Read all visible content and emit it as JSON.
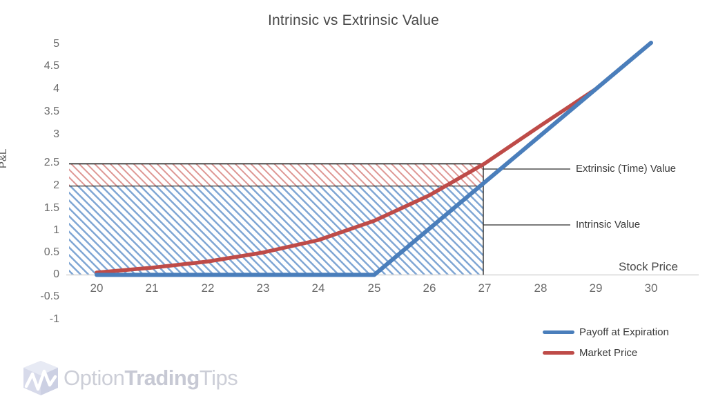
{
  "chart_data": {
    "type": "line",
    "title": "Intrinsic vs Extrinsic Value",
    "xlabel": "Stock Price",
    "ylabel": "P&L",
    "xlim": [
      19.5,
      30
    ],
    "ylim": [
      -1,
      5
    ],
    "grid": false,
    "legend_position": "bottom-right",
    "x_ticks": [
      20,
      21,
      22,
      23,
      24,
      25,
      26,
      27,
      28,
      29,
      30
    ],
    "x_tick_labels": [
      "20",
      "21",
      "22",
      "23",
      "24",
      "25",
      "26",
      "27",
      "28",
      "29",
      "30"
    ],
    "y_ticks": [
      -1,
      -0.5,
      0,
      0.5,
      1,
      1.5,
      2,
      2.5,
      3,
      3.5,
      4,
      4.5,
      5
    ],
    "y_tick_labels": [
      "-1",
      "-0.5",
      "0",
      "0.5",
      "1",
      "1.5",
      "2",
      "2.5",
      "3",
      "3.5",
      "4",
      "4.5",
      "5"
    ],
    "series": [
      {
        "name": "Payoff at Expiration",
        "color": "#4A7EBB",
        "x": [
          20,
          21,
          22,
          23,
          24,
          25,
          26,
          27,
          28,
          29,
          30
        ],
        "values": [
          0,
          0,
          0,
          0,
          0,
          0,
          1,
          2,
          3,
          4,
          5
        ]
      },
      {
        "name": "Market Price",
        "color": "#BE4B48",
        "x": [
          20,
          21,
          22,
          23,
          24,
          25,
          26,
          27,
          28,
          29,
          30
        ],
        "values": [
          0.05,
          0.15,
          0.3,
          0.5,
          0.78,
          1.2,
          1.78,
          2.5,
          3.35,
          4.18,
          5
        ]
      }
    ],
    "annotations": [
      {
        "label": "Extrinsic (Time) Value",
        "y_from": 2,
        "y_to": 2.5,
        "leader_y": 2.25,
        "at_x": 27
      },
      {
        "label": "Intrinsic Value",
        "y_from": 0,
        "y_to": 2,
        "leader_y": 1.1,
        "at_x": 27
      }
    ],
    "shaded_regions": [
      {
        "name": "intrinsic-value-region",
        "x_from": 19.5,
        "x_to": 27,
        "y_from": 0,
        "y_to": 2,
        "color": "#4A7EBB",
        "hatch": "diagonal"
      },
      {
        "name": "extrinsic-value-region",
        "x_from": 19.5,
        "x_to": 27,
        "y_from": 2,
        "y_to": 2.5,
        "color": "#BE4B48",
        "hatch": "diagonal"
      }
    ]
  },
  "watermark": {
    "text_light_1": "Option",
    "text_bold": "Trading",
    "text_light_2": "Tips"
  }
}
